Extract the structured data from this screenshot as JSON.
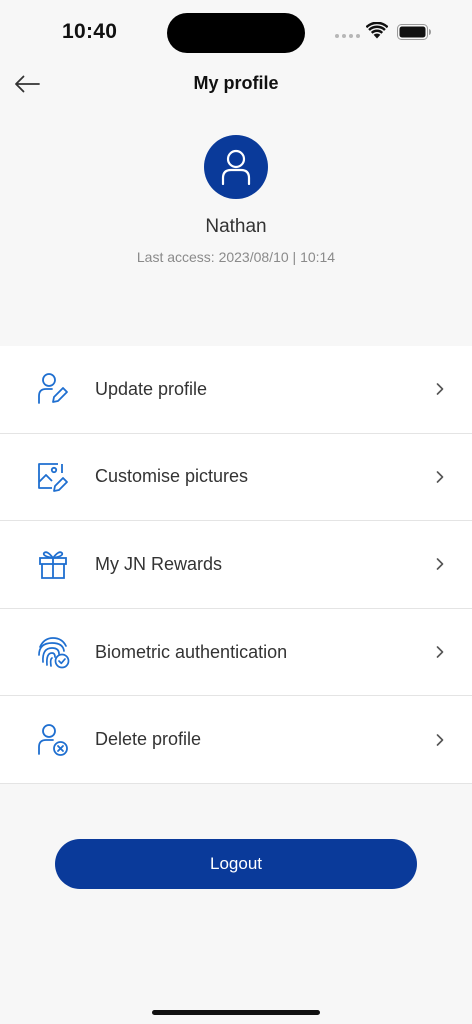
{
  "status_bar": {
    "time": "10:40"
  },
  "header": {
    "title": "My profile",
    "back_icon": "arrow-left-icon"
  },
  "profile": {
    "name": "Nathan",
    "last_access": "Last access: 2023/08/10 | 10:14",
    "avatar_icon": "user-icon"
  },
  "menu": {
    "items": [
      {
        "label": "Update profile",
        "icon": "user-edit-icon"
      },
      {
        "label": "Customise pictures",
        "icon": "image-edit-icon"
      },
      {
        "label": "My JN Rewards",
        "icon": "gift-icon"
      },
      {
        "label": "Biometric authentication",
        "icon": "fingerprint-check-icon"
      },
      {
        "label": "Delete profile",
        "icon": "user-remove-icon"
      }
    ]
  },
  "logout": {
    "label": "Logout"
  },
  "colors": {
    "primary": "#0a3a9a",
    "icon_blue": "#1f6fd0",
    "background": "#f7f7f7"
  }
}
